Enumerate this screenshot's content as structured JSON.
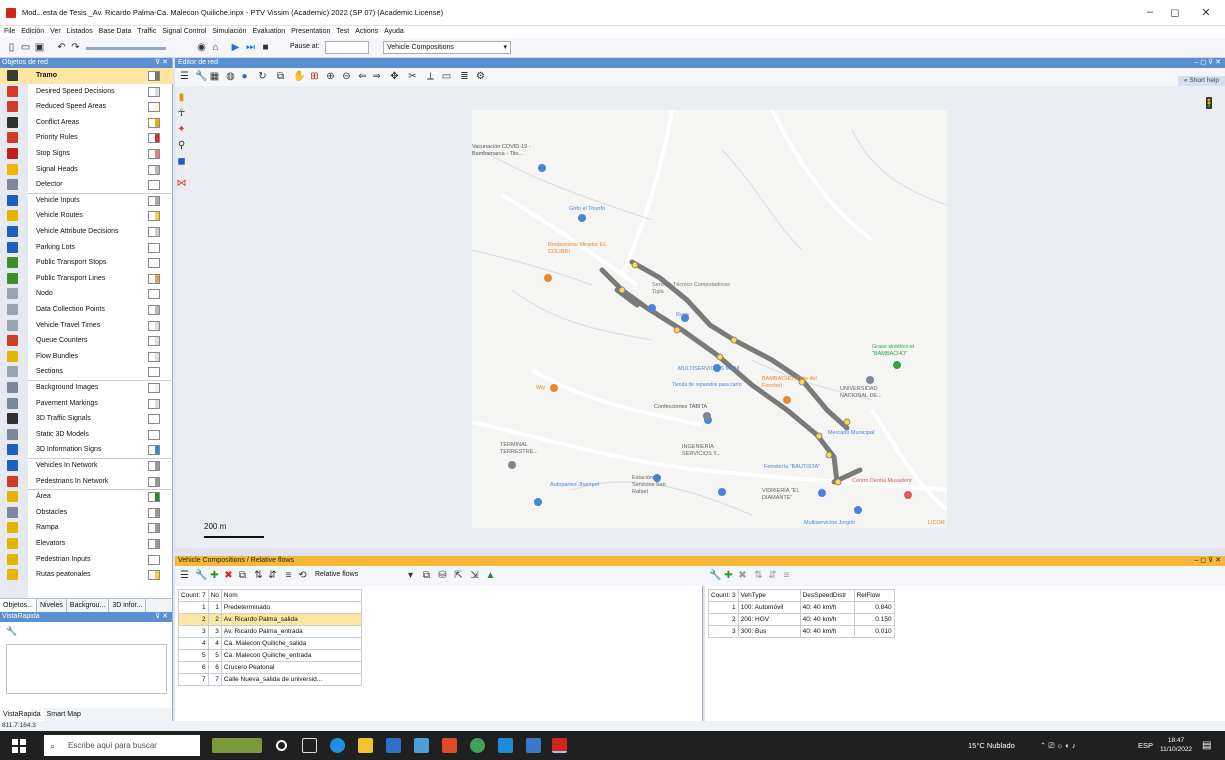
{
  "window": {
    "title": "Mod...esta de Tesis _Av. Ricardo Palma-Ca. Malecon Quiliche.inpx - PTV Vissim (Academic) 2022 (SP 07) (Academic License)",
    "min_glyph": "–",
    "max_glyph": "◻",
    "close_glyph": "✕"
  },
  "menu": [
    "File",
    "Edición",
    "Ver",
    "Listados",
    "Base Data",
    "Traffic",
    "Signal Control",
    "Simulación",
    "Evaluation",
    "Presentation",
    "Test",
    "Actions",
    "Ayuda"
  ],
  "toolbar": {
    "pause_label": "Pause at:",
    "pause_value": "",
    "vehicle_compositions": "Vehicle Compositions"
  },
  "left_panel": {
    "title": "Objetos de red",
    "items": [
      {
        "label": "Tramo",
        "color": "#3a3a3a",
        "swatch": "#777777",
        "selected": true
      },
      {
        "label": "Desired Speed Decisions",
        "color": "#d23b2a",
        "swatch": "#dddddd"
      },
      {
        "label": "Reduced Speed Areas",
        "color": "#d23b2a",
        "swatch": "#fff7c8"
      },
      {
        "label": "Conflict Areas",
        "color": "#2f2f2f",
        "swatch": "#e0b400"
      },
      {
        "label": "Priority Rules",
        "color": "#d23b2a",
        "swatch": "#d03030"
      },
      {
        "label": "Stop Signs",
        "color": "#c0201a",
        "swatch": "#e88080"
      },
      {
        "label": "Signal Heads",
        "color": "#f2b400",
        "swatch": "#bbbbbb"
      },
      {
        "label": "Detector",
        "color": "#7b879a",
        "swatch": "#ffffff"
      },
      {
        "label": "Vehicle Inputs",
        "color": "#1f5fb8",
        "swatch": "#aaaaaa"
      },
      {
        "label": "Vehicle Routes",
        "color": "#e5b400",
        "swatch": "#f2d240"
      },
      {
        "label": "Vehicle Attribute Decisions",
        "color": "#1f5fb8",
        "swatch": "#cccccc"
      },
      {
        "label": "Parking Lots",
        "color": "#1f5fb8",
        "swatch": "#ffffff"
      },
      {
        "label": "Public Transport Stops",
        "color": "#3f8f2a",
        "swatch": "#ffffff"
      },
      {
        "label": "Public Transport Lines",
        "color": "#3f8f2a",
        "swatch": "#e6a050"
      },
      {
        "label": "Nodo",
        "color": "#9aa3b0",
        "swatch": "#ffffff"
      },
      {
        "label": "Data Collection Points",
        "color": "#9aa3b0",
        "swatch": "#bbbbbb"
      },
      {
        "label": "Vehicle Travel Times",
        "color": "#9aa3b0",
        "swatch": "#dddddd"
      },
      {
        "label": "Queue Counters",
        "color": "#d23b2a",
        "swatch": "#dddddd"
      },
      {
        "label": "Flow Bundles",
        "color": "#e5b400",
        "swatch": "#dddddd"
      },
      {
        "label": "Sections",
        "color": "#9aa3b0",
        "swatch": "#ffffff"
      },
      {
        "label": "Background Images",
        "color": "#7b879a",
        "swatch": "#f0f0f0"
      },
      {
        "label": "Pavement Markings",
        "color": "#7b879a",
        "swatch": "#dddddd"
      },
      {
        "label": "3D Traffic Signals",
        "color": "#2f2f2f",
        "swatch": "#ffffff"
      },
      {
        "label": "Static 3D Models",
        "color": "#7b879a",
        "swatch": "#ffffff"
      },
      {
        "label": "3D Information Signs",
        "color": "#1f5fb8",
        "swatch": "#4a7fcf"
      },
      {
        "label": "Vehicles In Network",
        "color": "#1f5fb8",
        "swatch": "#999999"
      },
      {
        "label": "Pedestrians In Network",
        "color": "#d23b2a",
        "swatch": "#999999"
      },
      {
        "label": "Área",
        "color": "#e5b400",
        "swatch": "#2a8a2a"
      },
      {
        "label": "Obstacles",
        "color": "#7b879a",
        "swatch": "#999999"
      },
      {
        "label": "Rampa",
        "color": "#e5b400",
        "swatch": "#999999"
      },
      {
        "label": "Elevators",
        "color": "#e5b400",
        "swatch": "#999999"
      },
      {
        "label": "Pedestrian Inputs",
        "color": "#e5b400",
        "swatch": "#ffffff"
      },
      {
        "label": "Rutas peatonales",
        "color": "#e5b400",
        "swatch": "#f2d240"
      }
    ],
    "tabs": [
      "Objetos...",
      "Niveles",
      "Backgrou...",
      "3D infor..."
    ]
  },
  "vista": {
    "title": "VistaRapida",
    "tabs": [
      "VistaRapida",
      "Smart Map"
    ]
  },
  "status": {
    "coords": "811.7:164.3"
  },
  "editor": {
    "title": "Editor de red",
    "short_help": "« Short help",
    "scale_label": "200 m"
  },
  "map_labels": [
    "Vacunación COVID-19 - Bambamarca - Tito...",
    "Grifo el Triunfo",
    "Restaurante Mirador EL COLIBRI",
    "Servicio Técnico Computadoras Tigla",
    "Rosa",
    "Grass sintético el \"BAMBACHO\"",
    "MULTISERVICIOS MUNI",
    "Tienda de repuestos para carro",
    "BAMBACHO (Frito del Fonche)",
    "UNIVERSIDAD NACIONAL DE...",
    "Wly",
    "Confecciones TABITA",
    "Mercado Municipal",
    "TERMINAL TERRESTRE...",
    "Ferretería \"BAUTISTA\"",
    "Centro Dental Musadent",
    "INGENIERÍA SERVICIOS Y...",
    "Autopartes Jhampol",
    "Estación de Servicios San Rafael",
    "VIDRIERÍA \"EL DIAMANTE\"",
    "Multiservicios Jorgito",
    "LICOR"
  ],
  "vehicle_compositions": {
    "title": "Vehicle Compositions / Relative flows",
    "relative_flows": "Relative flows",
    "left_headers": [
      "Count: 7",
      "No",
      "Nom"
    ],
    "rows": [
      {
        "idx": "1",
        "no": "1",
        "name": "Predeterminado"
      },
      {
        "idx": "2",
        "no": "2",
        "name": "Av. Ricardo Palma_salida",
        "selected": true
      },
      {
        "idx": "3",
        "no": "3",
        "name": "Av. Ricardo Palma_entrada"
      },
      {
        "idx": "4",
        "no": "4",
        "name": "Ca. Malecon Quiliche_salida"
      },
      {
        "idx": "5",
        "no": "5",
        "name": "Ca. Malecon Quiliche_entrada"
      },
      {
        "idx": "6",
        "no": "6",
        "name": "Crucero Peatonal"
      },
      {
        "idx": "7",
        "no": "7",
        "name": "Calle Nueva_salida de universid..."
      }
    ],
    "right_headers": [
      "Count: 3",
      "VehType",
      "DesSpeedDistr",
      "RelFlow"
    ],
    "flows": [
      {
        "idx": "1",
        "vehtype": "100: Automóvil",
        "speed": "40: 40 km/h",
        "relflow": "0.840"
      },
      {
        "idx": "2",
        "vehtype": "200: HGV",
        "speed": "40: 40 km/h",
        "relflow": "0.150"
      },
      {
        "idx": "3",
        "vehtype": "300: Bus",
        "speed": "40: 40 km/h",
        "relflow": "0.010"
      }
    ]
  },
  "taskbar": {
    "search_placeholder": "Escribe aquí para buscar",
    "weather": "15°C Nublado",
    "lang": "ESP",
    "time": "18:47",
    "date": "11/10/2022"
  }
}
